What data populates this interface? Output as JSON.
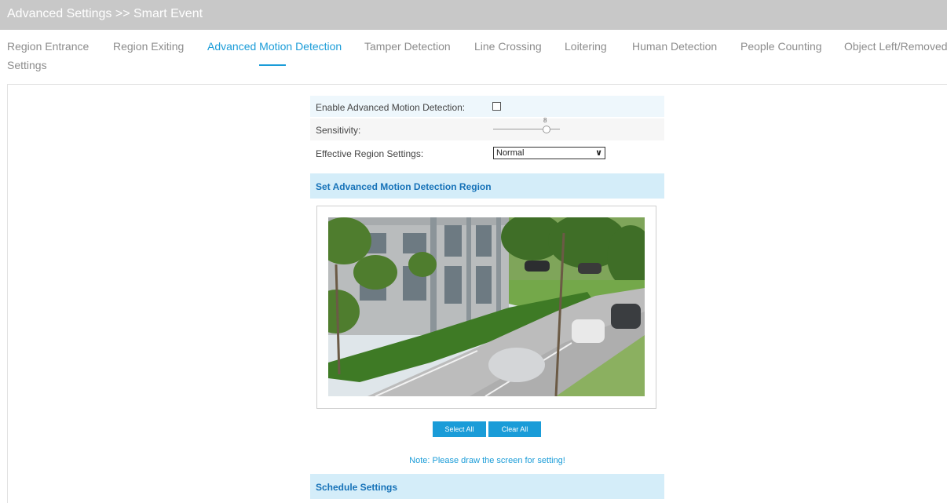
{
  "header": {
    "title": "Advanced Settings >> Smart Event"
  },
  "tabs": [
    {
      "label": "Region Entrance",
      "active": false
    },
    {
      "label": "Region Exiting",
      "active": false
    },
    {
      "label": "Advanced Motion Detection",
      "active": true
    },
    {
      "label": "Tamper Detection",
      "active": false
    },
    {
      "label": "Line Crossing",
      "active": false
    },
    {
      "label": "Loitering",
      "active": false
    },
    {
      "label": "Human Detection",
      "active": false
    },
    {
      "label": "People Counting",
      "active": false
    },
    {
      "label": "Object Left/Removed",
      "active": false
    }
  ],
  "tab_overflow": {
    "label": "Settings"
  },
  "form": {
    "enable_label": "Enable Advanced Motion Detection:",
    "enable_checked": false,
    "sensitivity_label": "Sensitivity:",
    "sensitivity_value": "8",
    "region_label": "Effective Region Settings:",
    "region_value": "Normal"
  },
  "region_section": {
    "title": "Set Advanced Motion Detection Region"
  },
  "buttons": {
    "select_all": "Select All",
    "clear_all": "Clear All"
  },
  "note": "Note: Please draw the screen for setting!",
  "schedule_section": {
    "title": "Schedule Settings"
  },
  "colors": {
    "accent": "#1a9cd8",
    "header_bg": "#c8c8c8",
    "section_bg": "#d4edf9"
  }
}
